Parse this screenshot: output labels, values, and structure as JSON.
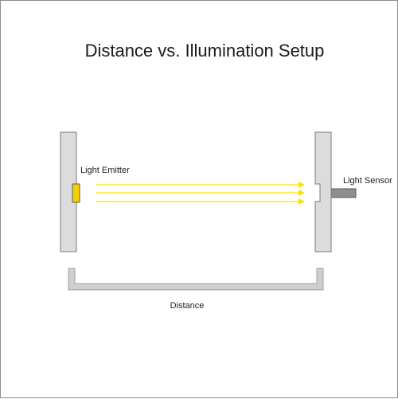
{
  "diagram": {
    "title": "Distance vs. Illumination Setup",
    "labels": {
      "emitter": "Light Emitter",
      "sensor": "Light Sensor",
      "distance": "Distance"
    },
    "components": {
      "emitter": "light-emitter",
      "sensor": "light-sensor",
      "rays": 3
    },
    "colors": {
      "panel_fill": "#dcdcdc",
      "panel_stroke": "#7a7a7a",
      "emitter_fill": "#f5d000",
      "ray": "#ffe100",
      "sensor_arm": "#8f8f8f",
      "bracket": "#cfcfcf"
    }
  }
}
